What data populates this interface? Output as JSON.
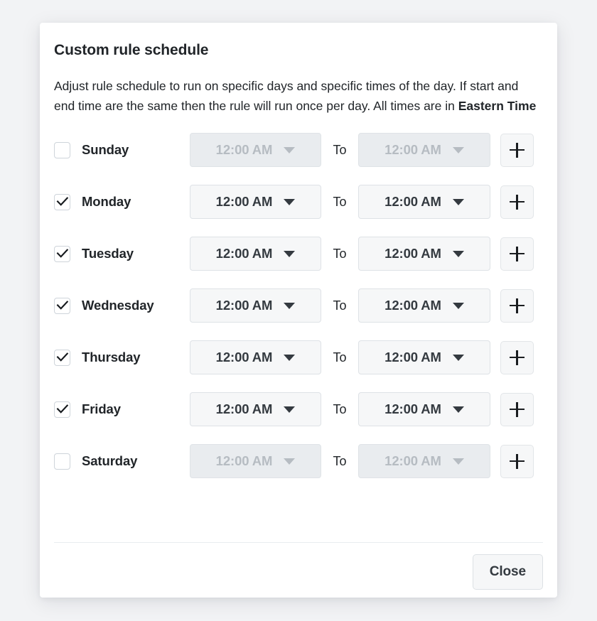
{
  "dialog": {
    "title": "Custom rule schedule",
    "description_prefix": "Adjust rule schedule to run on specific days and specific times of the day. If start and end time are the same then the rule will run once per day. All times are in ",
    "description_timezone": "Eastern Time",
    "to_label": "To",
    "add_label": "+",
    "close_label": "Close",
    "icons": {
      "checkbox_check": "check-icon",
      "select_caret": "chevron-down-icon",
      "add": "plus-icon"
    },
    "colors": {
      "page_background": "#f2f3f5",
      "card_background": "#ffffff",
      "text_primary": "#212529",
      "control_background": "#f6f7f8",
      "control_border": "#dee2e6",
      "disabled_background": "#e9ecef",
      "disabled_text": "#b6bcc2",
      "divider": "#e9ecef"
    },
    "rows": [
      {
        "day": "Sunday",
        "checked": false,
        "enabled": false,
        "start_time": "12:00 AM",
        "end_time": "12:00 AM"
      },
      {
        "day": "Monday",
        "checked": true,
        "enabled": true,
        "start_time": "12:00 AM",
        "end_time": "12:00 AM"
      },
      {
        "day": "Tuesday",
        "checked": true,
        "enabled": true,
        "start_time": "12:00 AM",
        "end_time": "12:00 AM"
      },
      {
        "day": "Wednesday",
        "checked": true,
        "enabled": true,
        "start_time": "12:00 AM",
        "end_time": "12:00 AM"
      },
      {
        "day": "Thursday",
        "checked": true,
        "enabled": true,
        "start_time": "12:00 AM",
        "end_time": "12:00 AM"
      },
      {
        "day": "Friday",
        "checked": true,
        "enabled": true,
        "start_time": "12:00 AM",
        "end_time": "12:00 AM"
      },
      {
        "day": "Saturday",
        "checked": false,
        "enabled": false,
        "start_time": "12:00 AM",
        "end_time": "12:00 AM"
      }
    ]
  }
}
